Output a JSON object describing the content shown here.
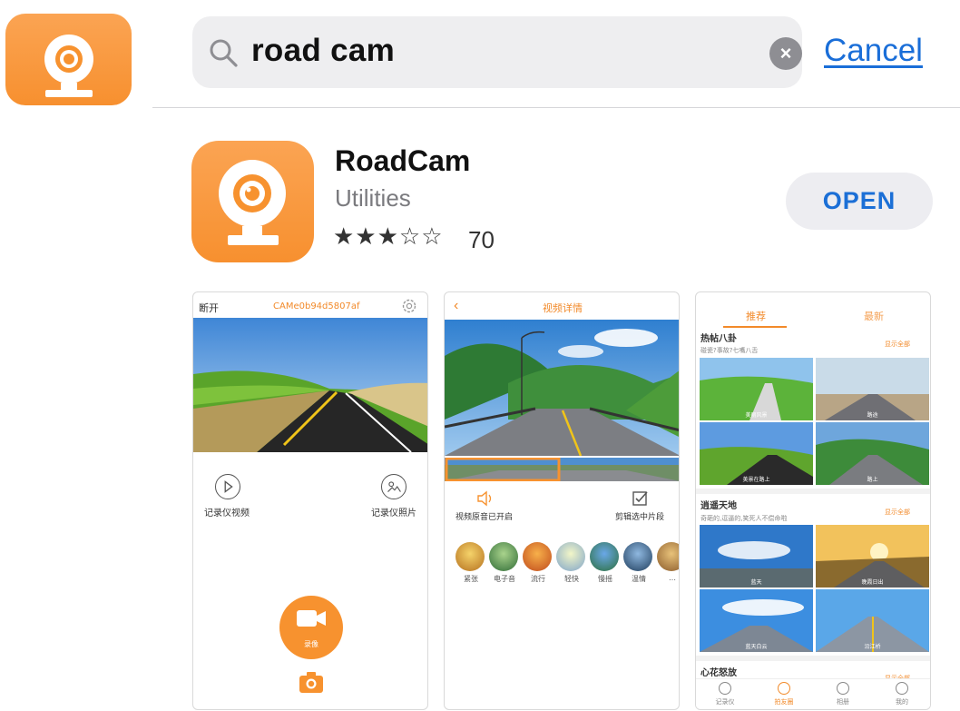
{
  "search": {
    "query": "road cam",
    "cancel_label": "Cancel"
  },
  "app": {
    "name": "RoadCam",
    "category": "Utilities",
    "stars_text": "★★★☆☆",
    "rating": 3,
    "rating_count": "70",
    "open_label": "OPEN"
  },
  "colors": {
    "brand_orange": "#f7922f",
    "link_blue": "#1a6ed8"
  },
  "screenshots": [
    {
      "status": "断开",
      "device_id": "CAMe0b94d5807af",
      "video_label": "记录仪视频",
      "photo_label": "记录仪照片",
      "record_label": "录像"
    },
    {
      "title": "视频详情",
      "audio_label": "视频原音已开启",
      "clip_label": "剪辑选中片段",
      "filters": [
        "紧张",
        "电子音",
        "流行",
        "轻快",
        "慢摇",
        "温情",
        "…"
      ]
    },
    {
      "tab_recommended": "推荐",
      "tab_latest": "最新",
      "section1_title": "热帖八卦",
      "section1_sub": "碰瓷?事故?七嘴八舌",
      "show_all": "显示全部",
      "tiles1": [
        "美丽风景",
        "路途",
        "美景在路上",
        "路上"
      ],
      "section2_title": "逍遥天地",
      "section2_sub": "奇葩的,逗逼的,笑死人不偿命啦",
      "tiles2": [
        "蓝天",
        "晚霞日出",
        "蓝天白云",
        "沿江桥"
      ],
      "section3_title": "心花怒放",
      "nav": [
        "记录仪",
        "拍友圈",
        "相册",
        "我的"
      ]
    }
  ]
}
